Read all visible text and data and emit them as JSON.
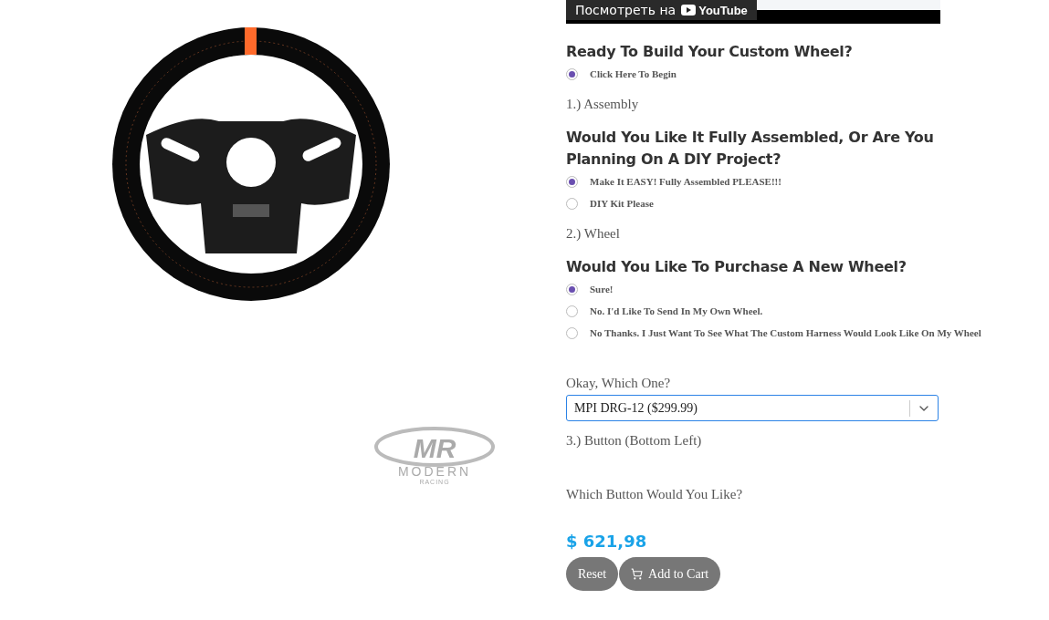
{
  "video": {
    "watch_label": "Посмотреть на",
    "platform": "YouTube"
  },
  "logo": {
    "initials": "MR",
    "name": "MODERN",
    "tagline": "RACING"
  },
  "form": [
    {
      "kind": "question",
      "heading": "Ready To Build Your Custom Wheel?",
      "options": [
        {
          "label": "Click Here To Begin",
          "selected": true
        }
      ]
    },
    {
      "kind": "step",
      "label": "1.) Assembly"
    },
    {
      "kind": "question",
      "heading": "Would You Like It Fully Assembled, Or Are You Planning On A DIY Project?",
      "options": [
        {
          "label": "Make It EASY! Fully Assembled PLEASE!!!",
          "selected": true
        },
        {
          "label": "DIY Kit Please",
          "selected": false
        }
      ]
    },
    {
      "kind": "step",
      "label": "2.) Wheel"
    },
    {
      "kind": "question",
      "heading": "Would You Like To Purchase A New Wheel?",
      "options": [
        {
          "label": "Sure!",
          "selected": true
        },
        {
          "label": "No. I'd Like To Send In My Own Wheel.",
          "selected": false
        },
        {
          "label": "No Thanks. I Just Want To See What The Custom Harness Would Look Like On My Wheel",
          "selected": false
        }
      ]
    },
    {
      "kind": "select",
      "label": "Okay, Which One?",
      "value": "MPI DRG-12 ($299.99)"
    },
    {
      "kind": "step",
      "label": "3.) Button (Bottom Left)"
    },
    {
      "kind": "prompt",
      "label": "Which Button Would You Like?"
    }
  ],
  "price": "$ 621,98",
  "buttons": [
    {
      "kind": "reset",
      "label": "Reset"
    },
    {
      "kind": "cart",
      "label": "Add to Cart"
    }
  ]
}
